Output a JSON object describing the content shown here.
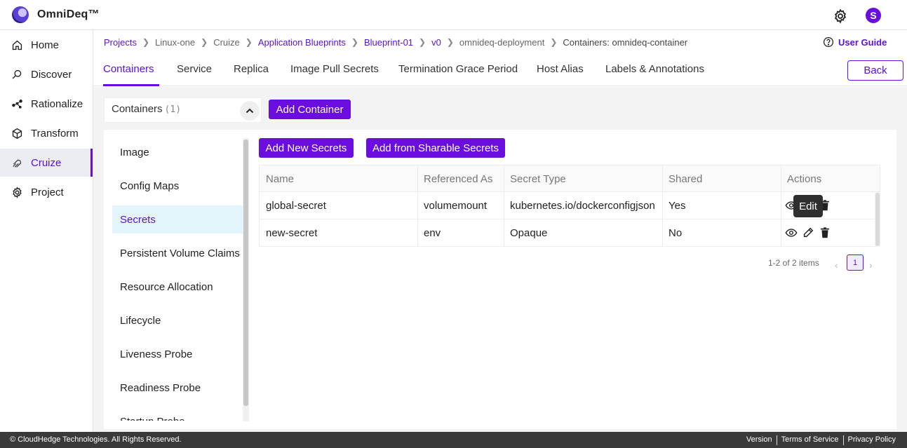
{
  "app": {
    "name": "OmniDeq™",
    "avatar_letter": "S"
  },
  "sidebar": {
    "items": [
      {
        "label": "Home",
        "icon": "home-icon"
      },
      {
        "label": "Discover",
        "icon": "discover-icon"
      },
      {
        "label": "Rationalize",
        "icon": "rationalize-icon"
      },
      {
        "label": "Transform",
        "icon": "transform-icon"
      },
      {
        "label": "Cruize",
        "icon": "cruize-icon",
        "active": true
      },
      {
        "label": "Project",
        "icon": "project-gear-icon"
      }
    ]
  },
  "breadcrumb": [
    {
      "label": "Projects",
      "link": true
    },
    {
      "label": "Linux-one",
      "link": false
    },
    {
      "label": "Cruize",
      "link": false
    },
    {
      "label": "Application Blueprints",
      "link": true
    },
    {
      "label": "Blueprint-01",
      "link": true
    },
    {
      "label": "v0",
      "link": true
    },
    {
      "label": "omnideq-deployment",
      "link": false
    },
    {
      "label": "Containers: omnideq-container",
      "link": false,
      "current": true
    }
  ],
  "user_guide": "User Guide",
  "tabs": [
    "Containers",
    "Service",
    "Replica",
    "Image Pull Secrets",
    "Termination Grace Period",
    "Host Alias",
    "Labels & Annotations"
  ],
  "back_label": "Back",
  "containers": {
    "title": "Containers",
    "count": "(1)",
    "add_label": "Add Container"
  },
  "subnav": [
    "Image",
    "Config Maps",
    "Secrets",
    "Persistent Volume Claims",
    "Resource Allocation",
    "Lifecycle",
    "Liveness Probe",
    "Readiness Probe",
    "Startup Probe"
  ],
  "secrets": {
    "add_new_label": "Add New Secrets",
    "add_sharable_label": "Add from Sharable Secrets",
    "columns": [
      "Name",
      "Referenced As",
      "Secret Type",
      "Shared",
      "Actions"
    ],
    "rows": [
      {
        "name": "global-secret",
        "referenced_as": "volumemount",
        "secret_type": "kubernetes.io/dockerconfigjson",
        "shared": "Yes"
      },
      {
        "name": "new-secret",
        "referenced_as": "env",
        "secret_type": "Opaque",
        "shared": "No"
      }
    ],
    "tooltip": "Edit",
    "pagination": {
      "info": "1-2 of 2 items",
      "current_page": "1",
      "prev": "‹",
      "next": "›"
    }
  },
  "footer": {
    "copyright": "© CloudHedge Technologies. All Rights Reserved.",
    "links": [
      "Version",
      "Terms of Service",
      "Privacy Policy"
    ]
  },
  "colors": {
    "accent": "#6a0dde",
    "active_bg": "#e3f5fb",
    "footer_bg": "#3a3a3a"
  }
}
